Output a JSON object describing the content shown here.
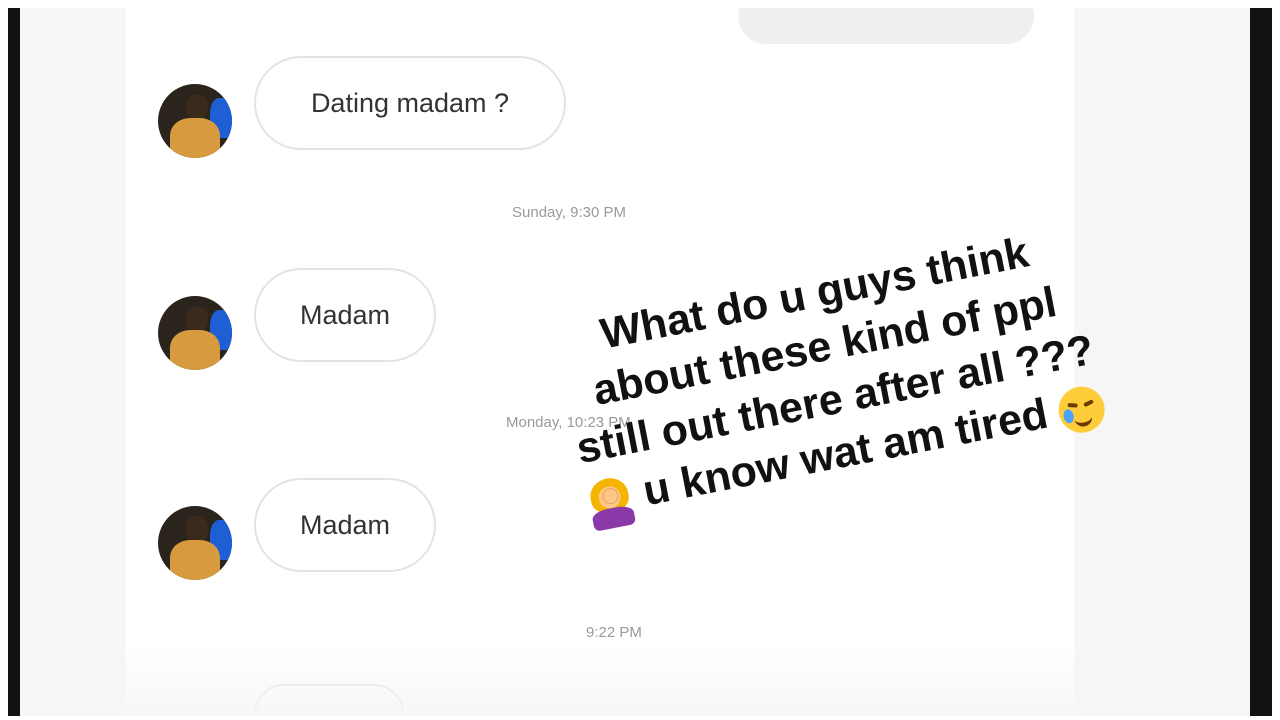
{
  "messages": [
    {
      "text": "Dating madam ?"
    },
    {
      "text": "Madam"
    },
    {
      "text": "Madam"
    }
  ],
  "timestamps": [
    "Sunday, 9:30 PM",
    "Monday, 10:23 PM",
    "9:22 PM"
  ],
  "overlay": {
    "lines": [
      "What do u guys think",
      "about these kind of ppl",
      "still out there after all ???",
      "u know wat am tired"
    ],
    "emojis": [
      "face-with-tear-emoji",
      "woman-facepalming-emoji"
    ]
  },
  "colors": {
    "bubble_border": "#e3e3e3",
    "timestamp": "#9a9a9a",
    "overlay_text": "#111111"
  }
}
